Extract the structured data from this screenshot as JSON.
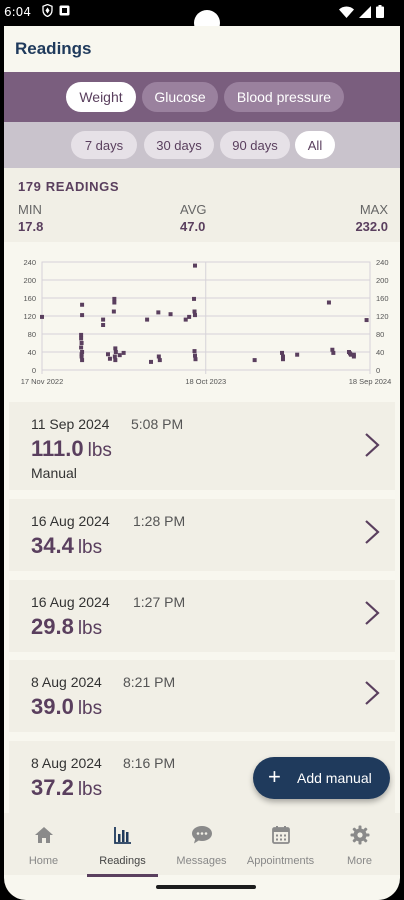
{
  "status_bar": {
    "time": "6:04"
  },
  "header": {
    "title": "Readings"
  },
  "reading_types": [
    {
      "label": "Weight",
      "active": true
    },
    {
      "label": "Glucose",
      "active": false
    },
    {
      "label": "Blood pressure",
      "active": false
    }
  ],
  "ranges": [
    {
      "label": "7 days",
      "active": false
    },
    {
      "label": "30 days",
      "active": false
    },
    {
      "label": "90 days",
      "active": false
    },
    {
      "label": "All",
      "active": true
    }
  ],
  "stats": {
    "count_label": "179 READINGS",
    "min_label": "MIN",
    "min_value": "17.8",
    "avg_label": "AVG",
    "avg_value": "47.0",
    "max_label": "MAX",
    "max_value": "232.0"
  },
  "chart_data": {
    "type": "scatter",
    "title": "",
    "xlabel": "",
    "ylabel": "",
    "x_tick_labels": [
      "17 Nov 2022",
      "18 Oct 2023",
      "18 Sep 2024"
    ],
    "y_ticks": [
      0,
      40,
      80,
      120,
      160,
      200,
      240
    ],
    "ylim": [
      0,
      240
    ],
    "xlim": [
      "2022-11-17",
      "2024-09-18"
    ],
    "grid": true,
    "color": "#5a3f5e",
    "points": [
      [
        "2022-11-17",
        118
      ],
      [
        "2023-02-07",
        145
      ],
      [
        "2023-02-07",
        122
      ],
      [
        "2023-02-05",
        70
      ],
      [
        "2023-02-06",
        60
      ],
      [
        "2023-02-05",
        50
      ],
      [
        "2023-02-07",
        40
      ],
      [
        "2023-02-06",
        30
      ],
      [
        "2023-02-07",
        22
      ],
      [
        "2023-02-05",
        78
      ],
      [
        "2023-02-06",
        35
      ],
      [
        "2023-03-22",
        112
      ],
      [
        "2023-03-22",
        100
      ],
      [
        "2023-04-01",
        35
      ],
      [
        "2023-04-05",
        25
      ],
      [
        "2023-04-14",
        158
      ],
      [
        "2023-04-14",
        150
      ],
      [
        "2023-04-13",
        130
      ],
      [
        "2023-04-16",
        48
      ],
      [
        "2023-04-17",
        40
      ],
      [
        "2023-04-15",
        30
      ],
      [
        "2023-04-16",
        22
      ],
      [
        "2023-04-25",
        33
      ],
      [
        "2023-05-03",
        38
      ],
      [
        "2023-06-20",
        112
      ],
      [
        "2023-06-28",
        18
      ],
      [
        "2023-07-13",
        128
      ],
      [
        "2023-07-14",
        30
      ],
      [
        "2023-07-16",
        22
      ],
      [
        "2023-08-07",
        124
      ],
      [
        "2023-09-07",
        112
      ],
      [
        "2023-09-14",
        118
      ],
      [
        "2023-09-26",
        232
      ],
      [
        "2023-09-24",
        158
      ],
      [
        "2023-09-25",
        130
      ],
      [
        "2023-09-26",
        122
      ],
      [
        "2023-09-25",
        42
      ],
      [
        "2023-09-26",
        32
      ],
      [
        "2023-09-27",
        24
      ],
      [
        "2024-01-26",
        22
      ],
      [
        "2024-03-22",
        38
      ],
      [
        "2024-03-24",
        30
      ],
      [
        "2024-03-24",
        24
      ],
      [
        "2024-04-22",
        34
      ],
      [
        "2024-06-26",
        150
      ],
      [
        "2024-07-03",
        45
      ],
      [
        "2024-07-05",
        38
      ],
      [
        "2024-08-06",
        40
      ],
      [
        "2024-08-08",
        37
      ],
      [
        "2024-08-10",
        34
      ],
      [
        "2024-08-16",
        30
      ],
      [
        "2024-08-16",
        34
      ],
      [
        "2024-09-11",
        111
      ]
    ]
  },
  "readings": [
    {
      "date": "11 Sep 2024",
      "time": "5:08 PM",
      "value": "111.0",
      "unit": "lbs",
      "source": "Manual"
    },
    {
      "date": "16 Aug 2024",
      "time": "1:28 PM",
      "value": "34.4",
      "unit": "lbs",
      "source": ""
    },
    {
      "date": "16 Aug 2024",
      "time": "1:27 PM",
      "value": "29.8",
      "unit": "lbs",
      "source": ""
    },
    {
      "date": "8 Aug 2024",
      "time": "8:21 PM",
      "value": "39.0",
      "unit": "lbs",
      "source": ""
    },
    {
      "date": "8 Aug 2024",
      "time": "8:16 PM",
      "value": "37.2",
      "unit": "lbs",
      "source": ""
    }
  ],
  "fab": {
    "label": "Add manual",
    "icon": "plus-icon"
  },
  "nav": [
    {
      "label": "Home",
      "icon": "home-icon",
      "active": false
    },
    {
      "label": "Readings",
      "icon": "bar-chart-icon",
      "active": true
    },
    {
      "label": "Messages",
      "icon": "chat-bubble-icon",
      "active": false
    },
    {
      "label": "Appointments",
      "icon": "calendar-icon",
      "active": false
    },
    {
      "label": "More",
      "icon": "gear-icon",
      "active": false
    }
  ]
}
